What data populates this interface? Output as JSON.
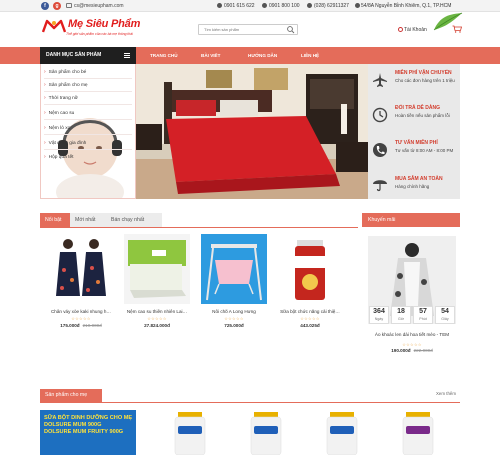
{
  "topbar": {
    "email": "cs@mesieupham.com",
    "phone1": "0901 615 622",
    "phone2": "0901 800 100",
    "phone3": "(028) 62911327",
    "address": "54/8A Nguyễn Bỉnh Khiêm, Q.1, TP.HCM"
  },
  "header": {
    "logo_text": "Mẹ Siêu Phẩm",
    "logo_sub": "Thế giới sản phẩm của các bà mẹ thông thái",
    "search_placeholder": "Tìm kiếm sản phẩm",
    "account": "Tài Khoản"
  },
  "nav": {
    "category_title": "DANH MỤC SẢN PHẨM",
    "items": [
      "TRANG CHỦ",
      "BÀI VIẾT",
      "HƯỚNG DẪN",
      "LIÊN HỆ"
    ]
  },
  "categories": [
    "Sản phẩm cho bé",
    "Sản phẩm cho mẹ",
    "Thời trang nữ",
    "Nệm cao su",
    "Nệm lò xo",
    "Vật dụng gia đình",
    "Hộp quà tết"
  ],
  "services": [
    {
      "title": "MIỄN PHÍ VẬN CHUYỂN",
      "desc": "Cho các đơn hàng trên 1 triệu",
      "icon": "plane-icon"
    },
    {
      "title": "ĐỔI TRẢ DỄ DÀNG",
      "desc": "Hoàn tiền nếu sản phẩm lỗi",
      "icon": "clock-icon"
    },
    {
      "title": "TƯ VẤN MIỄN PHÍ",
      "desc": "Tư vấn từ 8:00 AM - 8:00 PM",
      "icon": "phone-icon"
    },
    {
      "title": "MUA SẮM AN TOÀN",
      "desc": "Hàng chính hãng",
      "icon": "umbrella-icon"
    }
  ],
  "tabs": [
    "Nổi bật",
    "Mới nhất",
    "Bán chạy nhất"
  ],
  "products": [
    {
      "name": "Chân váy xòe kaki nhung h…",
      "price": "175.000đ",
      "old_price": "210.000đ",
      "rating": 0
    },
    {
      "name": "Nệm cao su thiên nhiên Lai…",
      "price": "27.824.000đ",
      "old_price": "",
      "rating": 0
    },
    {
      "name": "Nôi chõ A Long Hưng",
      "price": "725.000đ",
      "old_price": "",
      "rating": 0
    },
    {
      "name": "Sữa bột chức năng cải thiệ…",
      "price": "443.025đ",
      "old_price": "",
      "rating": 0
    }
  ],
  "promo": {
    "title": "Khuyến mãi",
    "countdown": [
      {
        "n": "364",
        "l": "Ngày"
      },
      {
        "n": "18",
        "l": "Giờ"
      },
      {
        "n": "57",
        "l": "Phút"
      },
      {
        "n": "54",
        "l": "Giây"
      }
    ],
    "name": "Áo khoác len dài hoa tiết mèo - TEM",
    "price": "190.000đ",
    "old_price": "222.000đ",
    "rating": 0
  },
  "section2": {
    "title": "Sản phẩm cho mẹ",
    "more": "Xem thêm",
    "ad_lines": [
      "SỮA BỘT DINH DƯỠNG CHO MẸ",
      "DOLSURE MUM 900G",
      "DOLSURE MUM FRUITY 900G"
    ]
  },
  "colors": {
    "accent": "#e46c5a",
    "dark": "#1f1f1f",
    "service_title": "#d23a2a",
    "star": "#e9a23b"
  }
}
